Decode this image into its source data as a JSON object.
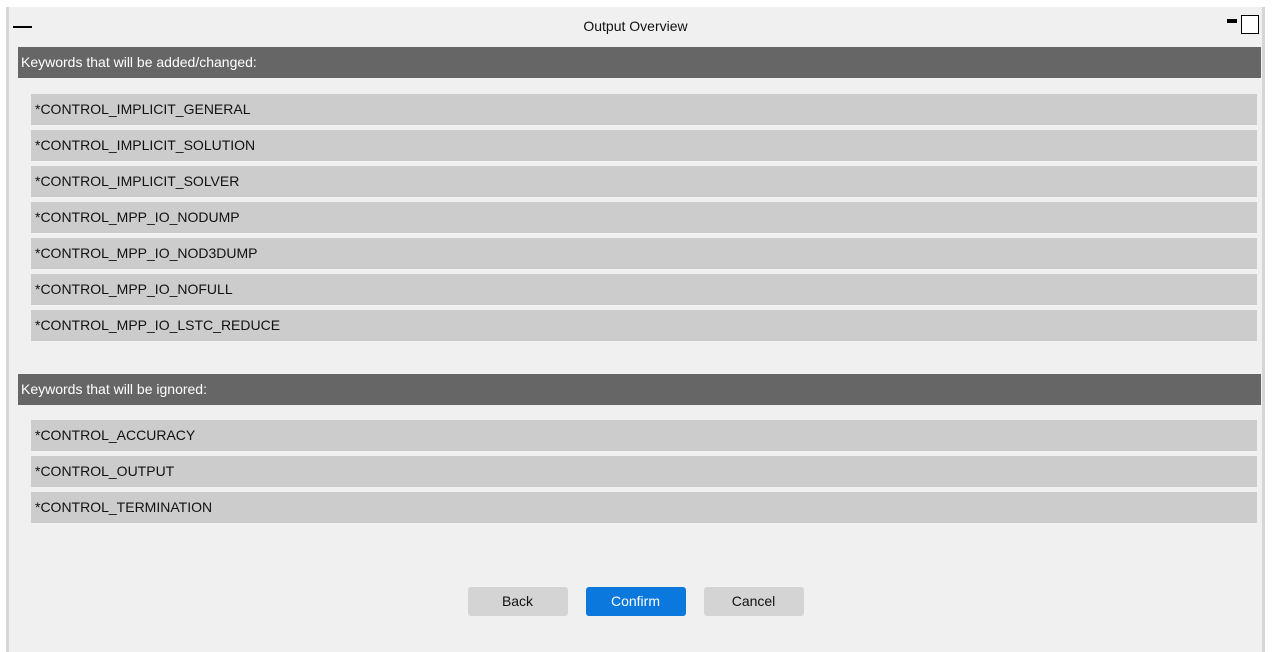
{
  "window": {
    "title": "Output Overview"
  },
  "sections": {
    "added": {
      "header": "Keywords that will be added/changed:",
      "items": [
        "*CONTROL_IMPLICIT_GENERAL",
        "*CONTROL_IMPLICIT_SOLUTION",
        "*CONTROL_IMPLICIT_SOLVER",
        "*CONTROL_MPP_IO_NODUMP",
        "*CONTROL_MPP_IO_NOD3DUMP",
        "*CONTROL_MPP_IO_NOFULL",
        "*CONTROL_MPP_IO_LSTC_REDUCE"
      ]
    },
    "ignored": {
      "header": "Keywords that will be ignored:",
      "items": [
        "*CONTROL_ACCURACY",
        "*CONTROL_OUTPUT",
        "*CONTROL_TERMINATION"
      ]
    }
  },
  "buttons": {
    "back": "Back",
    "confirm": "Confirm",
    "cancel": "Cancel"
  },
  "colors": {
    "section_header_bg": "#666666",
    "row_bg": "#cccccc",
    "primary_button": "#0a78dc",
    "window_bg": "#f0f0f0"
  },
  "icons": {
    "collapse": "collapse-dash-icon",
    "minimize": "minimize-icon",
    "maximize": "maximize-square-icon"
  }
}
